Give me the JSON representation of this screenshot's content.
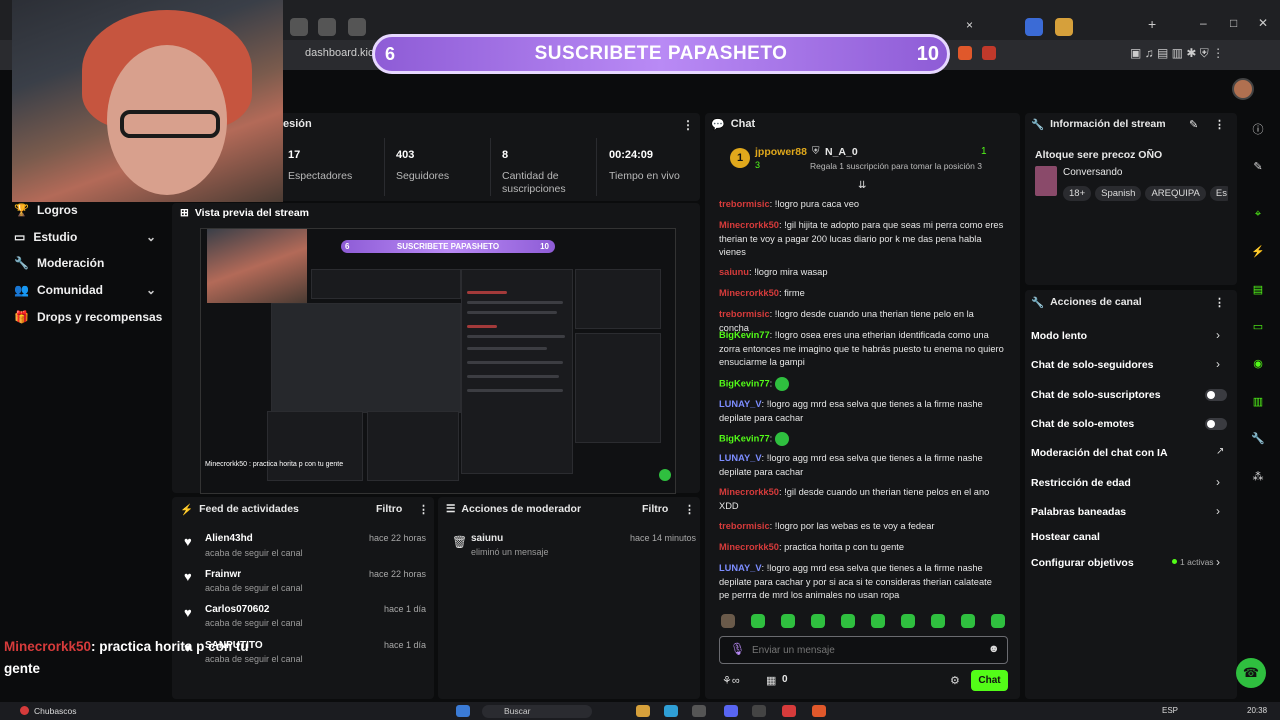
{
  "browser": {
    "url_text": "dashboard.kick.",
    "tabs_count_marker": "×"
  },
  "overlay": {
    "banner_left": "6",
    "banner_title": "SUSCRIBETE PAPASHETO",
    "banner_right": "10",
    "chat_user": "Minecrorkk50",
    "chat_text": ": practica horita p con tu gente"
  },
  "nav": {
    "items": [
      {
        "label": "Logros",
        "icon": "trophy-icon"
      },
      {
        "label": "Estudio",
        "icon": "camera-icon"
      },
      {
        "label": "Moderación",
        "icon": "wrench-icon"
      },
      {
        "label": "Comunidad",
        "icon": "people-icon"
      },
      {
        "label": "Drops y recompensas",
        "icon": "gift-icon"
      }
    ]
  },
  "session": {
    "header_partial": "esión",
    "stats": [
      {
        "value": "17",
        "label": "Espectadores"
      },
      {
        "value": "403",
        "label": "Seguidores"
      },
      {
        "value": "8",
        "label": "Cantidad de suscripciones"
      },
      {
        "value": "00:24:09",
        "label": "Tiempo en vivo"
      }
    ]
  },
  "preview": {
    "title": "Vista previa del stream",
    "mini_banner": "SUSCRIBETE PAPASHETO",
    "mini_left": "6",
    "mini_right": "10",
    "mini_overlay": "Minecrorkk50 : practica horita p con tu gente"
  },
  "feed": {
    "title": "Feed de actividades",
    "filter": "Filtro",
    "items": [
      {
        "name": "Alien43hd",
        "sub": "acaba de seguir el canal",
        "time": "hace 22 horas"
      },
      {
        "name": "Frainwr",
        "sub": "acaba de seguir el canal",
        "time": "hace 22 horas"
      },
      {
        "name": "Carlos070602",
        "sub": "acaba de seguir el canal",
        "time": "hace 1 día"
      },
      {
        "name": "SANPUTITO",
        "sub": "acaba de seguir el canal",
        "time": "hace 1 día"
      }
    ]
  },
  "modactions": {
    "title": "Acciones de moderador",
    "filter": "Filtro",
    "items": [
      {
        "name": "saiunu",
        "sub": "eliminó un mensaje",
        "time": "hace 14 minutos"
      }
    ]
  },
  "chat": {
    "title": "Chat",
    "top_user": "jppower88",
    "top_user_count": "3",
    "top_second": "N_A_0",
    "top_count": "1",
    "top_sub": "Regala 1 suscripción para tomar la posición 3",
    "messages": [
      {
        "user": "trebormisic",
        "text": ": !logro pura caca veo",
        "color": "red"
      },
      {
        "user": "Minecrorkk50",
        "text": ": !gil hijita te adopto para que seas mi perra como eres therian te voy a pagar 200 lucas diario por k me das pena habla vienes",
        "color": "red"
      },
      {
        "user": "saiunu",
        "text": ": !logro mira wasap",
        "color": "red"
      },
      {
        "user": "Minecrorkk50",
        "text": ": firme",
        "color": "red"
      },
      {
        "user": "trebormisic",
        "text": ": !logro desde cuando una therian tiene pelo en la concha",
        "color": "red"
      },
      {
        "user": "BigKevin77",
        "text": ": !logro osea eres una etherian identificada como una zorra entonces me imagino que te habrás puesto tu enema no quiero ensuciarme la gampi",
        "color": "green"
      },
      {
        "user": "BigKevin77",
        "text": ":",
        "color": "green"
      },
      {
        "user": "LUNAY_V",
        "text": ": !logro agg mrd esa selva que tienes a la firme nashe depilate para cachar",
        "color": "blue"
      },
      {
        "user": "BigKevin77",
        "text": ":",
        "color": "green"
      },
      {
        "user": "LUNAY_V",
        "text": ": !logro agg mrd esa selva que tienes a la firme nashe depilate para cachar",
        "color": "blue"
      },
      {
        "user": "Minecrorkk50",
        "text": ": !gil desde cuando un therian tiene pelos en el ano XDD",
        "color": "red"
      },
      {
        "user": "trebormisic",
        "text": ": !logro por las webas es te voy a fedear",
        "color": "red"
      },
      {
        "user": "Minecrorkk50",
        "text": ": practica horita p con tu gente",
        "color": "red"
      },
      {
        "user": "LUNAY_V",
        "text": ": !logro agg mrd esa selva que tienes a la firme nashe depilate para cachar y por si aca si te consideras therian calateate pe perrra de mrd los animales no usan ropa",
        "color": "blue"
      }
    ],
    "input_placeholder": "Enviar un mensaje",
    "bottom_count": "0",
    "send_label": "Chat"
  },
  "stream_info": {
    "title": "Información del stream",
    "stream_title": "Altoque sere precoz OÑO",
    "category": "Conversando",
    "tags": [
      "18+",
      "Spanish",
      "AREQUIPA",
      "Es"
    ]
  },
  "channel_actions": {
    "title": "Acciones de canal",
    "items": [
      {
        "label": "Modo lento",
        "control": "arrow"
      },
      {
        "label": "Chat de solo-seguidores",
        "control": "arrow"
      },
      {
        "label": "Chat de solo-suscriptores",
        "control": "toggle"
      },
      {
        "label": "Chat de solo-emotes",
        "control": "toggle"
      },
      {
        "label": "Moderación del chat con IA",
        "control": "external"
      },
      {
        "label": "Restricción de edad",
        "control": "arrow"
      },
      {
        "label": "Palabras baneadas",
        "control": "arrow"
      },
      {
        "label": "Hostear canal",
        "control": "none"
      },
      {
        "label": "Configurar objetivos",
        "control": "arrow",
        "badge": "1 activas"
      }
    ]
  },
  "taskbar": {
    "app_label": "Chubascos",
    "search_label": "Buscar",
    "lang": "ESP",
    "time": "20:38"
  },
  "colors": {
    "accent": "#53fc18",
    "banner": "#b98af5",
    "panel": "#141517"
  }
}
